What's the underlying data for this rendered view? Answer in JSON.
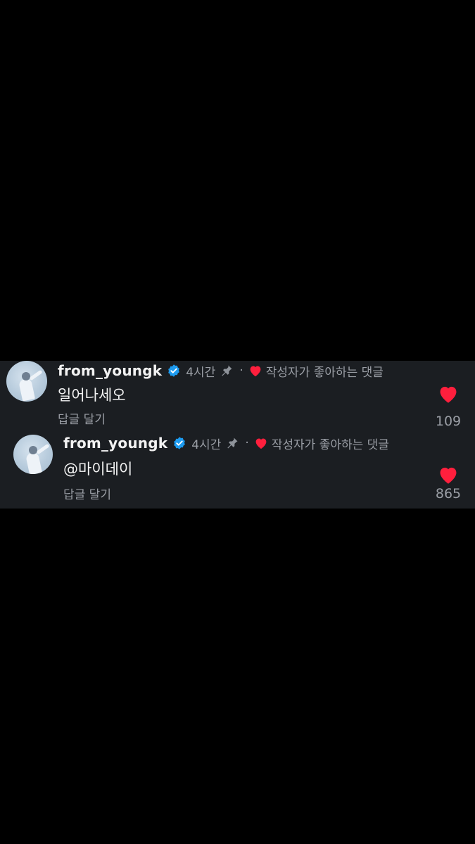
{
  "comments": [
    {
      "username": "from_youngk",
      "time": "4시간",
      "separator": "·",
      "author_liked": "작성자가 좋아하는 댓글",
      "text": "일어나세오",
      "reply_label": "답글 달기",
      "likes": "109",
      "avatar_icon": "avatar-photo",
      "verified_icon": "verified-badge-icon",
      "pin_icon": "pin-icon",
      "heart_color": "#ff1f3d",
      "verified_color": "#1d9bf0"
    },
    {
      "username": "from_youngk",
      "time": "4시간",
      "separator": "·",
      "author_liked": "작성자가 좋아하는 댓글",
      "text": "@마이데이",
      "reply_label": "답글 달기",
      "likes": "865",
      "avatar_icon": "avatar-photo",
      "verified_icon": "verified-badge-icon",
      "pin_icon": "pin-icon",
      "heart_color": "#ff1f3d",
      "verified_color": "#1d9bf0"
    }
  ]
}
